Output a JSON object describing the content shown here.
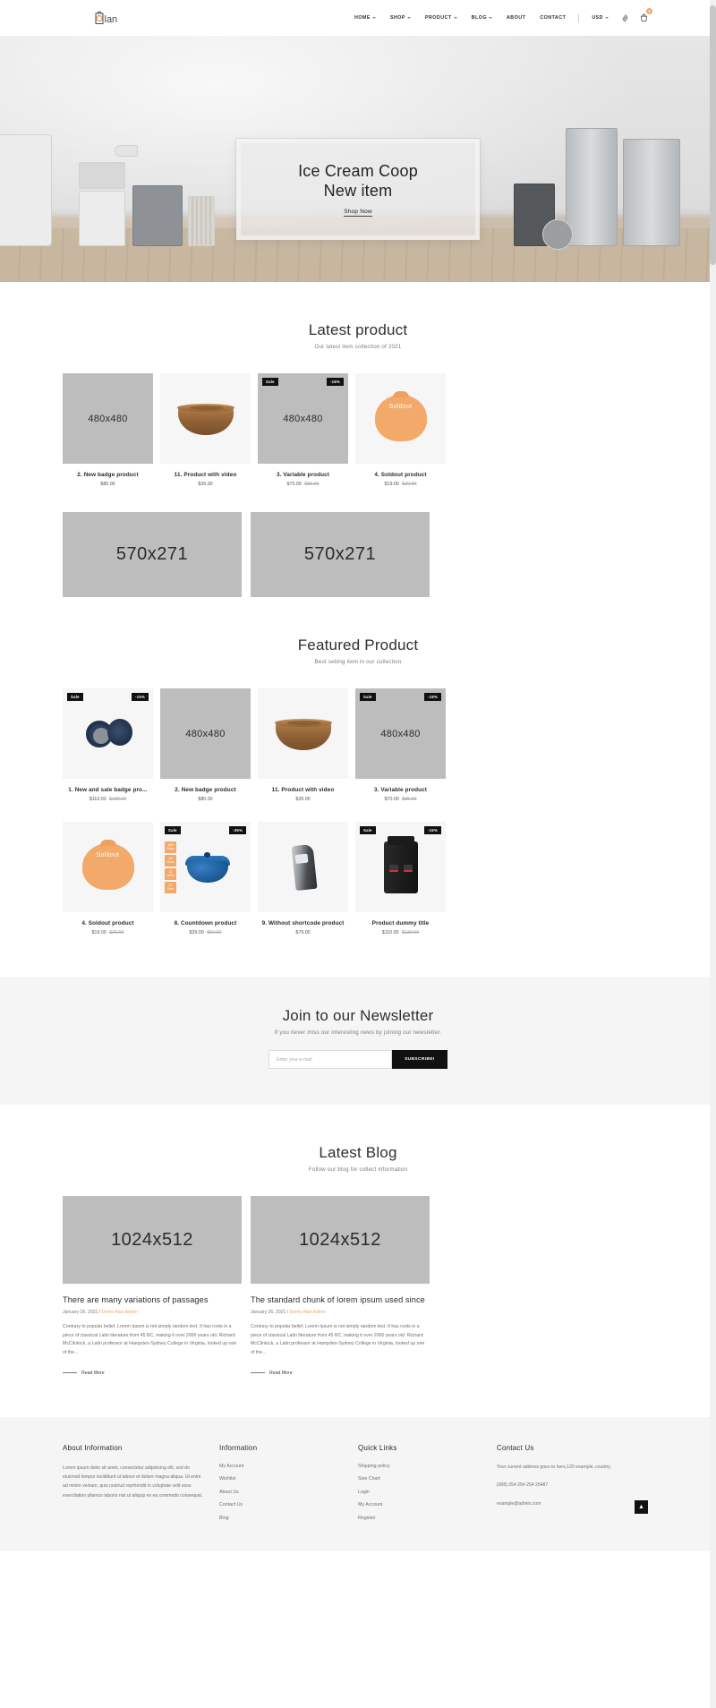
{
  "header": {
    "logo_text": "alan",
    "nav": [
      {
        "label": "HOME",
        "has_dropdown": true
      },
      {
        "label": "SHOP",
        "has_dropdown": true
      },
      {
        "label": "PRODUCT",
        "has_dropdown": true
      },
      {
        "label": "BLOG",
        "has_dropdown": true
      },
      {
        "label": "ABOUT",
        "has_dropdown": false
      },
      {
        "label": "CONTACT",
        "has_dropdown": false
      }
    ],
    "currency": "USD",
    "settings_icon": "gear-icon",
    "cart_icon": "cart-icon",
    "cart_count": "2"
  },
  "hero": {
    "title_line1": "Ice Cream Coop",
    "title_line2": "New item",
    "cta": "Shop Now"
  },
  "latest": {
    "title": "Latest product",
    "subtitle": "Our latest item collection of 2021",
    "products": [
      {
        "title": "2. New badge product",
        "price": "$80.00",
        "old_price": "",
        "placeholder": "480x480",
        "art": "placeholder",
        "badge_left": "",
        "badge_right": ""
      },
      {
        "title": "11. Product with video",
        "price": "$39.00",
        "old_price": "",
        "placeholder": "",
        "art": "bowl",
        "badge_left": "",
        "badge_right": ""
      },
      {
        "title": "3. Variable product",
        "price": "$70.00",
        "old_price": "$85.00",
        "placeholder": "480x480",
        "art": "placeholder",
        "badge_left": "Sale",
        "badge_right": "-18%"
      },
      {
        "title": "4. Soldout product",
        "price": "$19.00",
        "old_price": "$29.00",
        "placeholder": "",
        "art": "soldout",
        "badge_left": "",
        "badge_right": "",
        "overlay": "Soldout"
      }
    ]
  },
  "banners": [
    {
      "label": "570x271"
    },
    {
      "label": "570x271"
    }
  ],
  "featured": {
    "title": "Featured Product",
    "subtitle": "Best selling item in our collection",
    "products": [
      {
        "title": "1. New and sale badge pro...",
        "price": "$110.00",
        "old_price": "$130.00",
        "placeholder": "",
        "art": "pods",
        "badge_left": "Sale",
        "badge_right": "-15%"
      },
      {
        "title": "2. New badge product",
        "price": "$80.00",
        "old_price": "",
        "placeholder": "480x480",
        "art": "placeholder",
        "badge_left": "",
        "badge_right": ""
      },
      {
        "title": "11. Product with video",
        "price": "$39.00",
        "old_price": "",
        "placeholder": "",
        "art": "bowl",
        "badge_left": "",
        "badge_right": ""
      },
      {
        "title": "3. Variable product",
        "price": "$70.00",
        "old_price": "$85.00",
        "placeholder": "480x480",
        "art": "placeholder",
        "badge_left": "Sale",
        "badge_right": "-18%"
      },
      {
        "title": "4. Soldout product",
        "price": "$19.00",
        "old_price": "$29.00",
        "placeholder": "",
        "art": "soldout",
        "badge_left": "",
        "badge_right": "",
        "overlay": "Soldout"
      },
      {
        "title": "8. Countdown product",
        "price": "$39.00",
        "old_price": "$60.00",
        "placeholder": "",
        "art": "pot",
        "badge_left": "Sale",
        "badge_right": "-35%",
        "countdown": [
          {
            "value": "183",
            "unit": "Days"
          },
          {
            "value": "19",
            "unit": "Hour"
          },
          {
            "value": "11",
            "unit": "Mint"
          },
          {
            "value": "31",
            "unit": "Sec"
          }
        ]
      },
      {
        "title": "9. Without shortcode product",
        "price": "$79.00",
        "old_price": "",
        "placeholder": "",
        "art": "opener",
        "badge_left": "",
        "badge_right": ""
      },
      {
        "title": "Product dummy title",
        "price": "$110.00",
        "old_price": "$130.00",
        "placeholder": "",
        "art": "dispenser",
        "badge_left": "Sale",
        "badge_right": "-15%"
      }
    ]
  },
  "newsletter": {
    "title": "Join to our Newsletter",
    "subtitle": "If you never miss our interesting news by joining our newsletter.",
    "input_placeholder": "Enter your e-mail",
    "button": "SUBSCRIBE!"
  },
  "blog": {
    "title": "Latest Blog",
    "subtitle": "Follow our blog for collect information",
    "posts": [
      {
        "image": "1024x512",
        "title": "There are many variations of passages",
        "date": "January 26, 2021 /",
        "author": "Demo Alan Admin",
        "excerpt": "Contrary to popular belief, Lorem Ipsum is not simply random text. It has roots in a piece of classical Latin literature from 45 BC, making it over 2000 years old. Richard McClintock, a Latin professor at Hampden-Sydney College in Virginia, looked up one of the...",
        "read_more": "Read More"
      },
      {
        "image": "1024x512",
        "title": "The standard chunk of lorem ipsum used since",
        "date": "January 26, 2021 /",
        "author": "Demo Alan Admin",
        "excerpt": "Contrary to popular belief, Lorem Ipsum is not simply random text. It has roots in a piece of classical Latin literature from 45 BC, making it over 2000 years old. Richard McClintock, a Latin professor at Hampden-Sydney College in Virginia, looked up one of the...",
        "read_more": "Read More"
      }
    ]
  },
  "footer": {
    "about": {
      "title": "About Information",
      "text": "Lorem ipsum dolor sit amet, consectetur adipisicing elit, sed do eiusmod tempor incididunt ut labore et dolore magna aliqua. Ut enim ad minim veniam, quis nostrud reprhendit in voluptate velit esse exercitation ullamco laboris nisi ut aliquip ex ea commodo consequat."
    },
    "information": {
      "title": "Information",
      "links": [
        "My Account",
        "Wishlist",
        "About Us",
        "Contact Us",
        "Blog"
      ]
    },
    "quick_links": {
      "title": "Quick Links",
      "links": [
        "Shipping policy",
        "Size Chart",
        "Login",
        "My Account",
        "Register"
      ]
    },
    "contact": {
      "title": "Contact Us",
      "address": "Your current address goes to here,120 example, country.",
      "phone": "(008) 254 254 254 25487",
      "email": "example@admin.com"
    },
    "back_to_top": "▲"
  }
}
